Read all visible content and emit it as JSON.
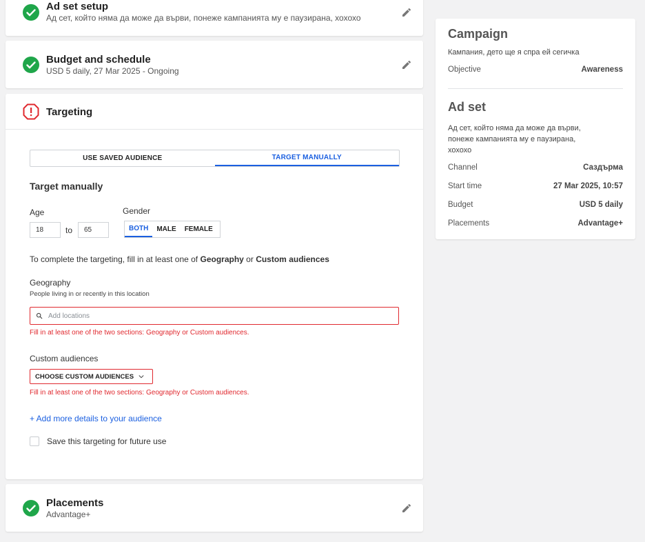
{
  "sections": {
    "ad_set_setup": {
      "title": "Ad set setup",
      "subtitle": "Ад сет, който няма да може да върви, понеже кампанията му е паузирана, хохохо"
    },
    "budget": {
      "title": "Budget and schedule",
      "subtitle": "USD 5 daily, 27 Mar 2025 - Ongoing"
    },
    "targeting": {
      "title": "Targeting",
      "tabs": {
        "saved": "USE SAVED AUDIENCE",
        "manual": "TARGET MANUALLY"
      },
      "heading": "Target manually",
      "age": {
        "label": "Age",
        "min": "18",
        "to": "to",
        "max": "65"
      },
      "gender": {
        "label": "Gender",
        "options": [
          "BOTH",
          "MALE",
          "FEMALE"
        ],
        "selected": "BOTH"
      },
      "hint": {
        "prefix": "To complete the targeting, fill in at least one of ",
        "geo": "Geography",
        "or": " or ",
        "custom": "Custom audiences"
      },
      "geography": {
        "label": "Geography",
        "sublabel": "People living in or recently in this location",
        "placeholder": "Add locations",
        "error": "Fill in at least one of the two sections: Geography or Custom audiences."
      },
      "custom_audiences": {
        "label": "Custom audiences",
        "button": "CHOOSE CUSTOM AUDIENCES",
        "error": "Fill in at least one of the two sections: Geography or Custom audiences."
      },
      "more_details": "+ Add more details to your audience",
      "save_label": "Save this targeting for future use"
    },
    "placements": {
      "title": "Placements",
      "subtitle": "Advantage+"
    }
  },
  "sidebar": {
    "campaign": {
      "heading": "Campaign",
      "name": "Кампания, дето ще я спра ей сегичка",
      "objective_label": "Objective",
      "objective_value": "Awareness"
    },
    "adset": {
      "heading": "Ad set",
      "name": "Ад сет, който няма да може да върви, понеже кампанията му е паузирана, хохохо",
      "rows": [
        {
          "label": "Channel",
          "value": "Саздърма"
        },
        {
          "label": "Start time",
          "value": "27 Mar 2025, 10:57"
        },
        {
          "label": "Budget",
          "value": "USD 5 daily"
        },
        {
          "label": "Placements",
          "value": "Advantage+"
        }
      ]
    }
  },
  "colors": {
    "success": "#1fa64a",
    "error": "#e0282e",
    "accent": "#1a5fe0"
  },
  "icons": {
    "complete": "check-circle-icon",
    "warning": "alert-octagon-icon",
    "edit": "pencil-icon",
    "search": "search-icon",
    "chevron": "chevron-down-icon"
  }
}
